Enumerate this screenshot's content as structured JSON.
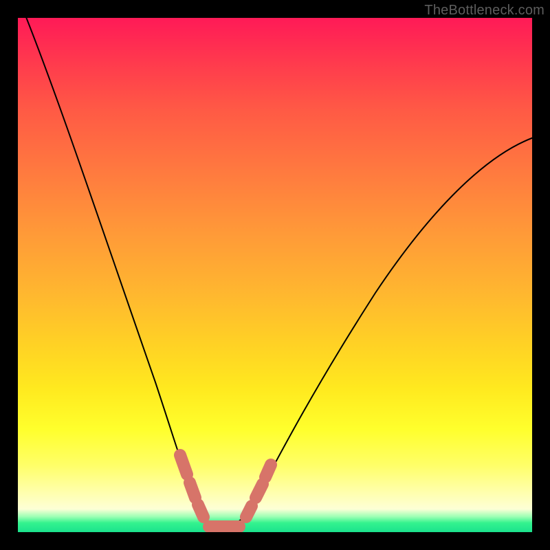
{
  "watermark": "TheBottleneck.com",
  "chart_data": {
    "type": "line",
    "title": "",
    "xlabel": "",
    "ylabel": "",
    "xlim": [
      0,
      100
    ],
    "ylim": [
      0,
      100
    ],
    "series": [
      {
        "name": "bottleneck-curve",
        "x": [
          0,
          5,
          10,
          15,
          20,
          25,
          30,
          33,
          35,
          37,
          40,
          43,
          47,
          55,
          65,
          75,
          85,
          95,
          100
        ],
        "values": [
          100,
          90,
          79,
          68,
          56,
          43,
          28,
          16,
          8,
          3,
          1,
          2,
          6,
          17,
          32,
          46,
          58,
          68,
          72
        ]
      }
    ],
    "highlight_range_x": [
      31,
      47
    ],
    "minimum_x": 40
  }
}
